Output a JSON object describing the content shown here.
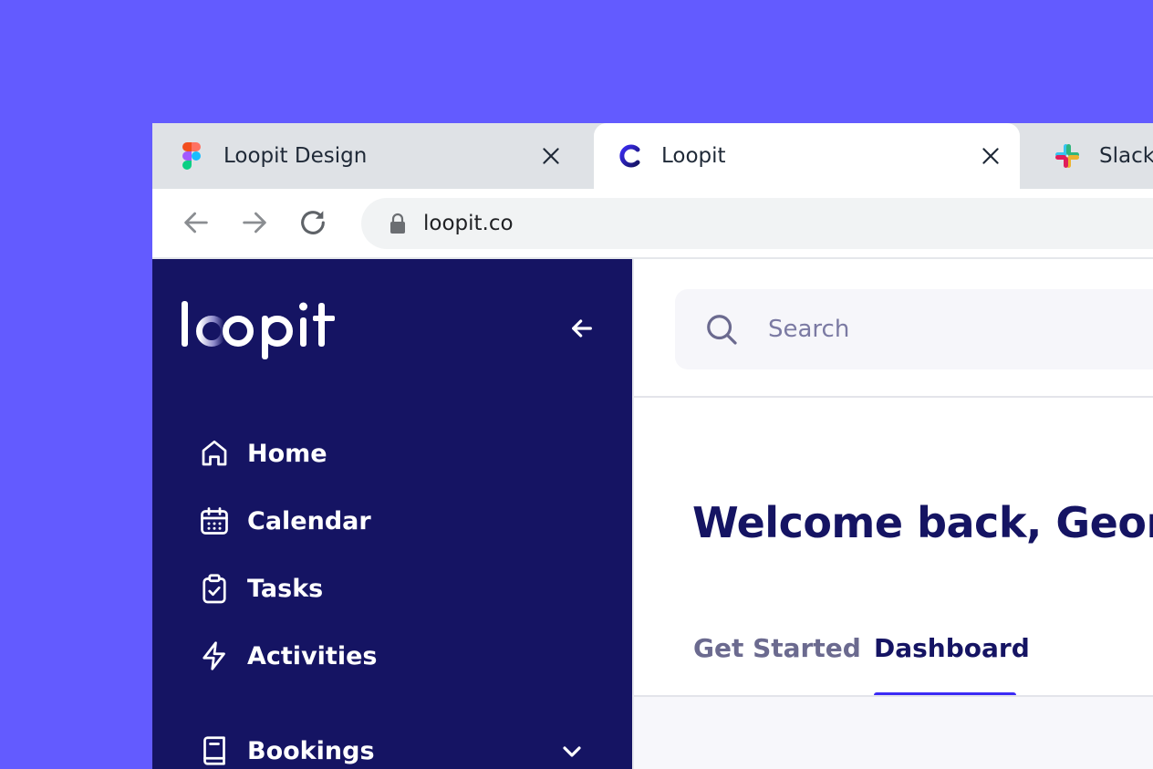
{
  "browser": {
    "tabs": [
      {
        "label": "Loopit Design",
        "icon": "figma-icon",
        "active": false
      },
      {
        "label": "Loopit",
        "icon": "loopit-icon",
        "active": true
      },
      {
        "label": "Slack",
        "icon": "slack-icon",
        "active": false
      }
    ],
    "url": "loopit.co"
  },
  "sidebar": {
    "logo_text": "loopit",
    "items": [
      {
        "label": "Home",
        "icon": "home-icon"
      },
      {
        "label": "Calendar",
        "icon": "calendar-icon"
      },
      {
        "label": "Tasks",
        "icon": "clipboard-check-icon"
      },
      {
        "label": "Activities",
        "icon": "lightning-icon"
      },
      {
        "label": "Bookings",
        "icon": "book-icon"
      }
    ]
  },
  "main": {
    "search": {
      "placeholder": "Search"
    },
    "welcome": "Welcome back, George",
    "tabs": [
      {
        "label": "Get Started",
        "active": false
      },
      {
        "label": "Dashboard",
        "active": true
      }
    ]
  },
  "colors": {
    "background": "#635bff",
    "sidebar": "#151463",
    "accent": "#3b2bf5",
    "heading": "#151463"
  }
}
